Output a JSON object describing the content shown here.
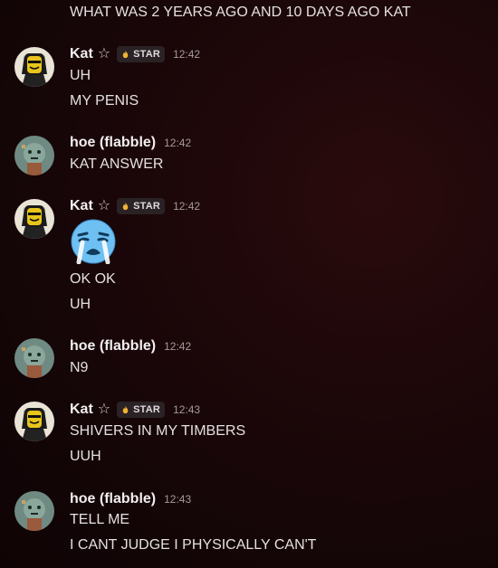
{
  "top_message": "WHAT WAS 2 YEARS AGO AND 10 DAYS AGO KAT",
  "users": {
    "kat": {
      "name": "Kat",
      "tag": "STAR"
    },
    "hoe": {
      "name": "hoe (flabble)"
    }
  },
  "messages": [
    {
      "author": "Kat",
      "time": "12:42",
      "lines": [
        "UH",
        "MY PENIS"
      ]
    },
    {
      "author": "hoe (flabble)",
      "time": "12:42",
      "lines": [
        "KAT ANSWER"
      ]
    },
    {
      "author": "Kat",
      "time": "12:42",
      "emoji": "loudly-crying-face-icon",
      "lines": [
        "OK OK",
        "UH"
      ]
    },
    {
      "author": "hoe (flabble)",
      "time": "12:42",
      "lines": [
        "N9"
      ]
    },
    {
      "author": "Kat",
      "time": "12:43",
      "lines": [
        "SHIVERS IN MY TIMBERS",
        "UUH"
      ]
    },
    {
      "author": "hoe (flabble)",
      "time": "12:43",
      "lines": [
        "TELL ME",
        "I CANT JUDGE I PHYSICALLY CAN'T"
      ]
    }
  ],
  "colors": {
    "background": "#1c0709",
    "text": "#e4e0e1",
    "timestamp": "#a49a9c",
    "tag_background": "#2a2225"
  }
}
